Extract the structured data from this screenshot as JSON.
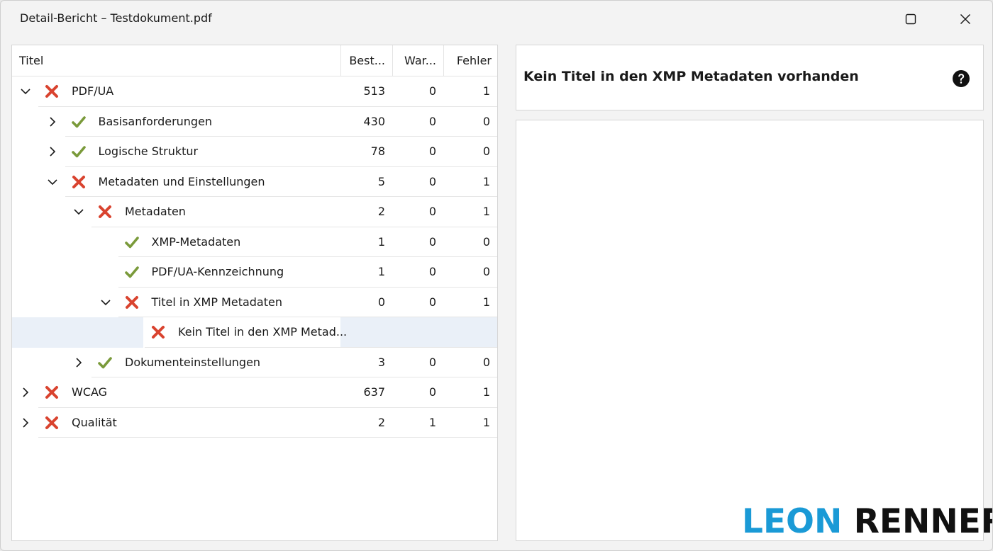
{
  "window": {
    "title": "Detail-Bericht – Testdokument.pdf"
  },
  "tree": {
    "headers": {
      "titel": "Titel",
      "bestanden": "Best...",
      "warnungen": "War...",
      "fehler": "Fehler"
    },
    "rows": [
      {
        "label": "PDF/UA",
        "level": 0,
        "expander": "expanded",
        "status": "fail",
        "b": "513",
        "w": "0",
        "f": "1"
      },
      {
        "label": "Basisanforderungen",
        "level": 1,
        "expander": "collapsed",
        "status": "pass",
        "b": "430",
        "w": "0",
        "f": "0"
      },
      {
        "label": "Logische Struktur",
        "level": 1,
        "expander": "collapsed",
        "status": "pass",
        "b": "78",
        "w": "0",
        "f": "0"
      },
      {
        "label": "Metadaten und Einstellungen",
        "level": 1,
        "expander": "expanded",
        "status": "fail",
        "b": "5",
        "w": "0",
        "f": "1"
      },
      {
        "label": "Metadaten",
        "level": 2,
        "expander": "expanded",
        "status": "fail",
        "b": "2",
        "w": "0",
        "f": "1"
      },
      {
        "label": "XMP-Metadaten",
        "level": 3,
        "expander": "none",
        "status": "pass",
        "b": "1",
        "w": "0",
        "f": "0"
      },
      {
        "label": "PDF/UA-Kennzeichnung",
        "level": 3,
        "expander": "none",
        "status": "pass",
        "b": "1",
        "w": "0",
        "f": "0"
      },
      {
        "label": "Titel in XMP Metadaten",
        "level": 3,
        "expander": "expanded",
        "status": "fail",
        "b": "0",
        "w": "0",
        "f": "1"
      },
      {
        "label": "Kein Titel in den XMP Metad...",
        "level": 4,
        "expander": "none",
        "status": "fail",
        "b": "",
        "w": "",
        "f": "",
        "selected": true
      },
      {
        "label": "Dokumenteinstellungen",
        "level": 2,
        "expander": "collapsed",
        "status": "pass",
        "b": "3",
        "w": "0",
        "f": "0"
      },
      {
        "label": "WCAG",
        "level": 0,
        "expander": "collapsed",
        "status": "fail",
        "b": "637",
        "w": "0",
        "f": "1"
      },
      {
        "label": "Qualität",
        "level": 0,
        "expander": "collapsed",
        "status": "fail",
        "b": "2",
        "w": "1",
        "f": "1"
      }
    ]
  },
  "message": {
    "title": "Kein Titel in den XMP Metadaten vorhanden"
  },
  "brand": {
    "first": "LEON",
    "last": "RENNER"
  },
  "colors": {
    "fail": "#d9432f",
    "pass": "#7a9a3a",
    "brand_blue": "#1a9ad6",
    "selected_row": "#eaf0f8"
  },
  "icons": {
    "maximize": "maximize-icon",
    "close": "close-icon",
    "help": "help-icon",
    "pass": "check-icon",
    "fail": "cross-icon"
  }
}
